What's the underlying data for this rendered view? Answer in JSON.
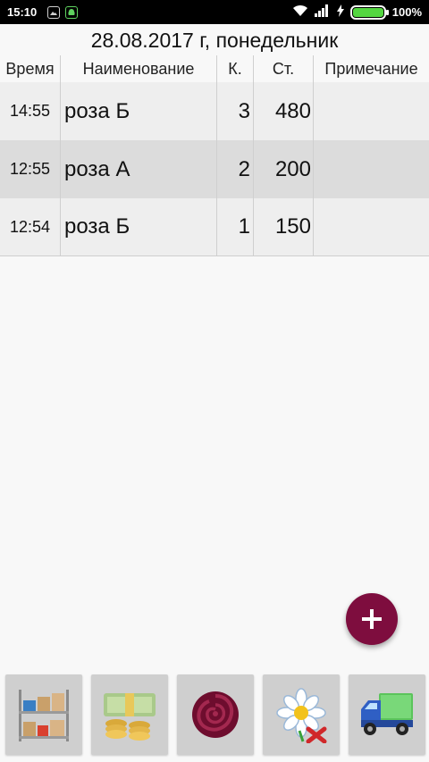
{
  "status_bar": {
    "time": "15:10",
    "battery": "100%"
  },
  "header": {
    "date": "28.08.2017 г, понедельник"
  },
  "table": {
    "columns": [
      "Время",
      "Наименование",
      "К.",
      "Ст.",
      "Примечание"
    ],
    "rows": [
      {
        "time": "14:55",
        "name": "роза Б",
        "qty": "3",
        "cost": "480",
        "note": ""
      },
      {
        "time": "12:55",
        "name": "роза А",
        "qty": "2",
        "cost": "200",
        "note": ""
      },
      {
        "time": "12:54",
        "name": "роза Б",
        "qty": "1",
        "cost": "150",
        "note": ""
      }
    ]
  },
  "fab": {
    "icon": "plus-icon",
    "color": "#7e0d3e"
  },
  "toolbar": {
    "buttons": [
      {
        "icon": "warehouse-shelves-icon"
      },
      {
        "icon": "money-coins-icon"
      },
      {
        "icon": "rose-icon"
      },
      {
        "icon": "daisy-writeoff-icon"
      },
      {
        "icon": "delivery-truck-icon"
      }
    ]
  }
}
